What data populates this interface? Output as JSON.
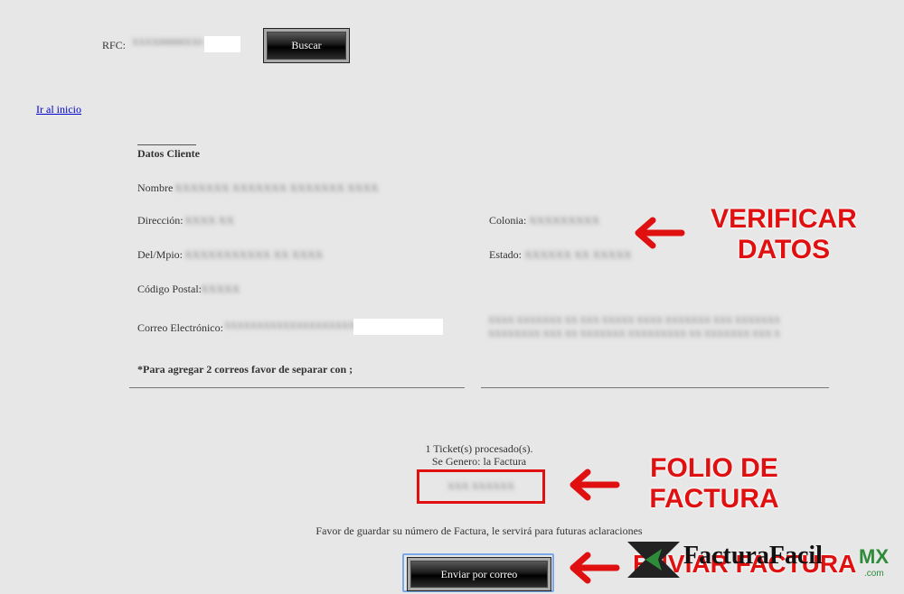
{
  "search": {
    "rfc_label": "RFC:",
    "rfc_value": "XXXX000000XX0",
    "button_label": "Buscar"
  },
  "nav": {
    "home_link": "Ir al inicio"
  },
  "client": {
    "section_title": "Datos Cliente",
    "fields": {
      "nombre_label": "Nombre",
      "nombre_value": "XXXXXXX XXXXXXX XXXXXXX XXXX",
      "direccion_label": "Dirección:",
      "direccion_value": "XXXX XX",
      "colonia_label": "Colonia:",
      "colonia_value": "XXXXXXXXX",
      "delmpio_label": "Del/Mpio:",
      "delmpio_value": "XXXXXXXXXXX XX XXXX",
      "estado_label": "Estado:",
      "estado_value": "XXXXXX XX XXXXX",
      "cp_label": "Código Postal:",
      "cp_value": "XXXXX",
      "email_label": "Correo Electrónico:",
      "email_value": "XXXXXXXXXXXXXXXXXXXXX.XXX"
    },
    "note": "*Para agregar 2 correos favor de separar con ;",
    "side_text_line1": "XXXX XXXXXXX XX XXX XXXXX XXXX XXXXXXX XXX XXXXXXX XX XXX XXXXX",
    "side_text_line2": "XXXXXXXX XXX XX XXXXXXX XXXXXXXXX XX XXXXXXX XXX XXXXXXXXXX XXX"
  },
  "result": {
    "processed": "1 Ticket(s) procesado(s).",
    "generated": "Se Genero: la Factura",
    "folio": "XXX XXXXXX",
    "save_note": "Favor de guardar su número de Factura, le servirá para futuras aclaraciones",
    "send_button": "Enviar por correo"
  },
  "annotations": {
    "verify_line1": "VERIFICAR",
    "verify_line2": "DATOS",
    "folio_line1": "FOLIO DE",
    "folio_line2": "FACTURA",
    "send_text": "ENVIAR FACTURA",
    "color": "#e01010"
  },
  "watermark": {
    "brand": "FacturaFacil",
    "suffix": "MX",
    "domain": ".com"
  }
}
